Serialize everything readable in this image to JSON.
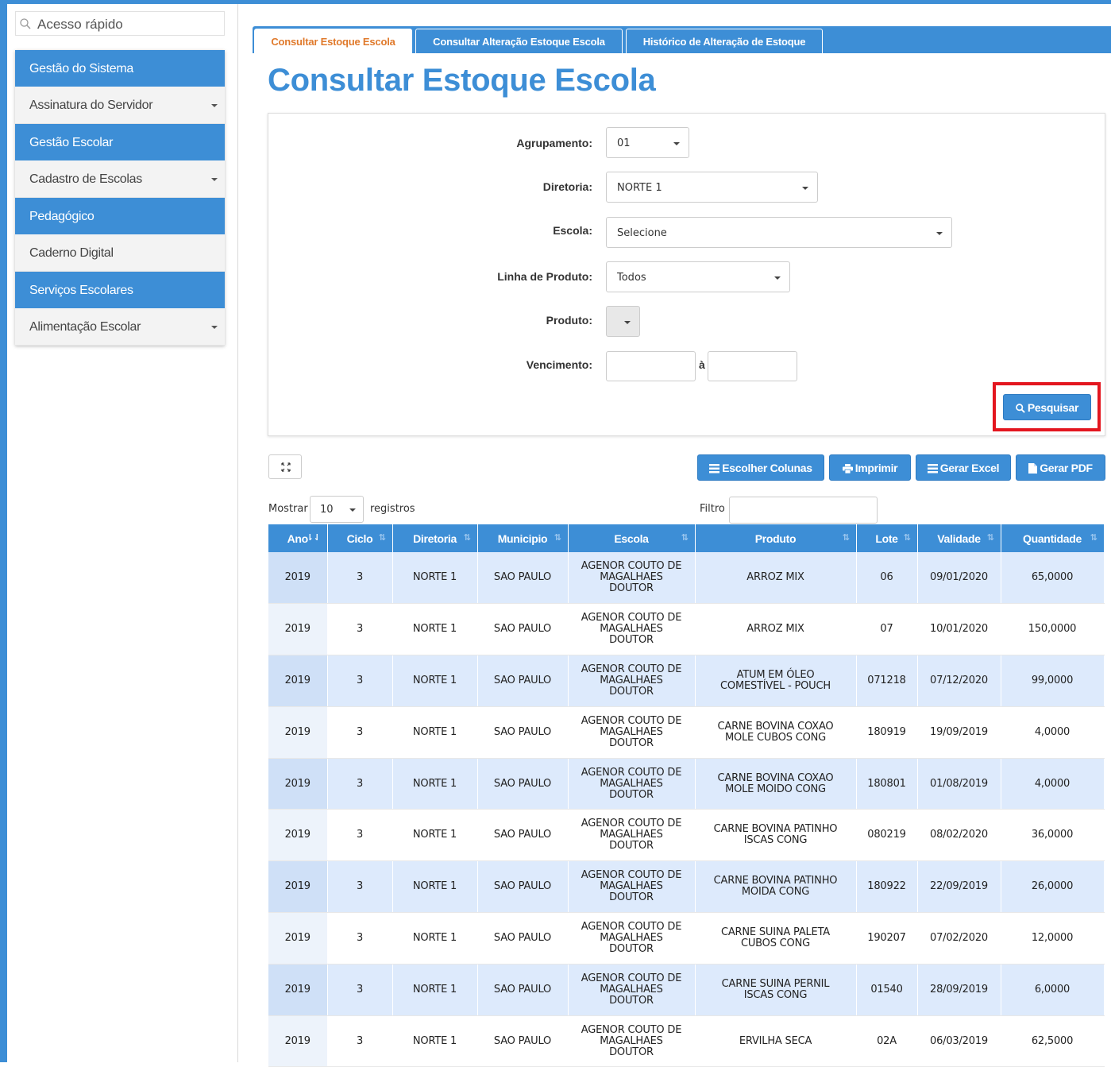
{
  "quick_access": {
    "placeholder": "Acesso rápido"
  },
  "sidebar": [
    {
      "kind": "head",
      "label": "Gestão do Sistema"
    },
    {
      "kind": "item",
      "label": "Assinatura do Servidor",
      "caret": true
    },
    {
      "kind": "head",
      "label": "Gestão Escolar"
    },
    {
      "kind": "item",
      "label": "Cadastro de Escolas",
      "caret": true
    },
    {
      "kind": "head",
      "label": "Pedagógico"
    },
    {
      "kind": "item",
      "label": "Caderno Digital",
      "caret": false
    },
    {
      "kind": "head",
      "label": "Serviços Escolares"
    },
    {
      "kind": "item",
      "label": "Alimentação Escolar",
      "caret": true
    }
  ],
  "tabs": [
    "Consultar Estoque Escola",
    "Consultar Alteração Estoque Escola",
    "Histórico de Alteração de Estoque"
  ],
  "page_title": "Consultar Estoque Escola",
  "form": {
    "agrupamento_label": "Agrupamento:",
    "agrupamento_value": "01",
    "diretoria_label": "Diretoria:",
    "diretoria_value": "NORTE 1",
    "escola_label": "Escola:",
    "escola_value": "Selecione",
    "linha_label": "Linha de Produto:",
    "linha_value": "Todos",
    "produto_label": "Produto:",
    "vencimento_label": "Vencimento:",
    "ate_label": "à",
    "search_button": "Pesquisar"
  },
  "toolbar": {
    "columns_button": "Escolher Colunas",
    "print_button": "Imprimir",
    "excel_button": "Gerar Excel",
    "pdf_button": "Gerar PDF"
  },
  "table_controls": {
    "show_label": "Mostrar",
    "page_length": "10",
    "records_label": "registros",
    "filter_label": "Filtro"
  },
  "accent_color": "#3d8ed6",
  "highlight_color": "#e3161f",
  "table": {
    "columns": [
      "Ano",
      "Ciclo",
      "Diretoria",
      "Municipio",
      "Escola",
      "Produto",
      "Lote",
      "Validade",
      "Quantidade"
    ],
    "rows": [
      [
        "2019",
        "3",
        "NORTE 1",
        "SAO PAULO",
        "AGENOR COUTO DE MAGALHAES DOUTOR",
        "ARROZ MIX",
        "06",
        "09/01/2020",
        "65,0000"
      ],
      [
        "2019",
        "3",
        "NORTE 1",
        "SAO PAULO",
        "AGENOR COUTO DE MAGALHAES DOUTOR",
        "ARROZ MIX",
        "07",
        "10/01/2020",
        "150,0000"
      ],
      [
        "2019",
        "3",
        "NORTE 1",
        "SAO PAULO",
        "AGENOR COUTO DE MAGALHAES DOUTOR",
        "ATUM EM ÓLEO COMESTÍVEL - POUCH",
        "071218",
        "07/12/2020",
        "99,0000"
      ],
      [
        "2019",
        "3",
        "NORTE 1",
        "SAO PAULO",
        "AGENOR COUTO DE MAGALHAES DOUTOR",
        "CARNE BOVINA COXAO MOLE CUBOS CONG",
        "180919",
        "19/09/2019",
        "4,0000"
      ],
      [
        "2019",
        "3",
        "NORTE 1",
        "SAO PAULO",
        "AGENOR COUTO DE MAGALHAES DOUTOR",
        "CARNE BOVINA COXAO MOLE MOIDO CONG",
        "180801",
        "01/08/2019",
        "4,0000"
      ],
      [
        "2019",
        "3",
        "NORTE 1",
        "SAO PAULO",
        "AGENOR COUTO DE MAGALHAES DOUTOR",
        "CARNE BOVINA PATINHO ISCAS CONG",
        "080219",
        "08/02/2020",
        "36,0000"
      ],
      [
        "2019",
        "3",
        "NORTE 1",
        "SAO PAULO",
        "AGENOR COUTO DE MAGALHAES DOUTOR",
        "CARNE BOVINA PATINHO MOIDA CONG",
        "180922",
        "22/09/2019",
        "26,0000"
      ],
      [
        "2019",
        "3",
        "NORTE 1",
        "SAO PAULO",
        "AGENOR COUTO DE MAGALHAES DOUTOR",
        "CARNE SUINA PALETA CUBOS CONG",
        "190207",
        "07/02/2020",
        "12,0000"
      ],
      [
        "2019",
        "3",
        "NORTE 1",
        "SAO PAULO",
        "AGENOR COUTO DE MAGALHAES DOUTOR",
        "CARNE SUINA PERNIL ISCAS CONG",
        "01540",
        "28/09/2019",
        "6,0000"
      ],
      [
        "2019",
        "3",
        "NORTE 1",
        "SAO PAULO",
        "AGENOR COUTO DE MAGALHAES DOUTOR",
        "ERVILHA SECA",
        "02A",
        "06/03/2019",
        "62,5000"
      ]
    ]
  }
}
